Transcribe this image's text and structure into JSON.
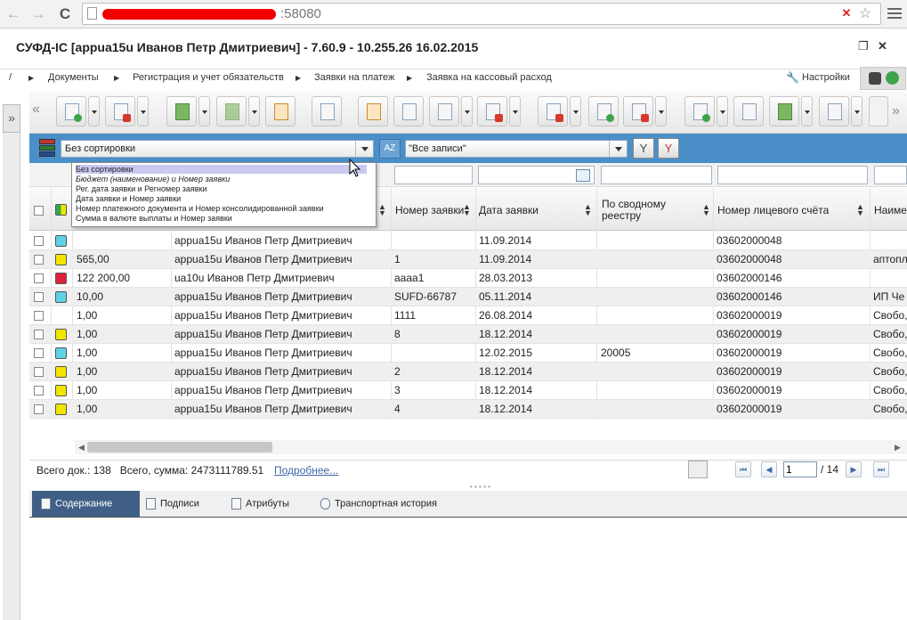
{
  "browser": {
    "back": "←",
    "forward": "→",
    "reload": "C",
    "url_tail": ":58080"
  },
  "app": {
    "title": "СУФД-IC [appua15u Иванов Петр Дмитриевич] - 7.60.9 - 10.255.26 16.02.2015",
    "restore_glyph": "❐",
    "close_glyph": "✕"
  },
  "breadcrumb": {
    "root": "/",
    "items": [
      "Документы",
      "Регистрация и учет обязательств",
      "Заявки на платеж",
      "Заявка на кассовый расход"
    ],
    "settings": "Настройки"
  },
  "left_rail": {
    "expand_glyph": "»"
  },
  "toolbar": {
    "collapse_glyph": "«"
  },
  "filter_bar": {
    "sort_value": "Без сортировки",
    "az_label": "AZ",
    "records_value": "\"Все записи\"",
    "filter_glyph": "Y",
    "clear_filter_glyph": "Y"
  },
  "sort_dropdown": {
    "options": [
      "Без сортировки",
      "Бюджет (наименование) и Номер заявки",
      "Рег. дата заявки и Регномер заявки",
      "Дата заявки и Номер заявки",
      "Номер платежного документа и Номер консолидированной заявки",
      "Сумма в валюте выплаты и Номер заявки"
    ]
  },
  "grid": {
    "headers": {
      "request_no": "Номер заявки",
      "request_date": "Дата заявки",
      "summary_registry_1": "По сводному",
      "summary_registry_2": "реестру",
      "account_no": "Номер лицевого счёта",
      "name": "Наиме"
    },
    "sort_glyph": "⬍",
    "rows": [
      {
        "status_color": "#5fd3e6",
        "amount": "",
        "author": "appua15u Иванов Петр Дмитриевич",
        "number": "",
        "date": "11.09.2014",
        "registry": "",
        "account": "03602000048",
        "name": ""
      },
      {
        "status_color": "#f2e600",
        "amount": "565,00",
        "author": "appua15u Иванов Петр Дмитриевич",
        "number": "1",
        "date": "11.09.2014",
        "registry": "",
        "account": "03602000048",
        "name": "аптопл"
      },
      {
        "status_color": "#e0213b",
        "amount": "122 200,00",
        "author": "ua10u Иванов Петр Дмитриевич",
        "number": "аааа1",
        "date": "28.03.2013",
        "registry": "",
        "account": "03602000146",
        "name": ""
      },
      {
        "status_color": "#5fd3e6",
        "amount": "10,00",
        "author": "appua15u Иванов Петр Дмитриевич",
        "number": "SUFD-66787",
        "date": "05.11.2014",
        "registry": "",
        "account": "03602000146",
        "name": "ИП Че"
      },
      {
        "status_color": "",
        "amount": "1,00",
        "author": "appua15u Иванов Петр Дмитриевич",
        "number": "1111",
        "date": "26.08.2014",
        "registry": "",
        "account": "03602000019",
        "name": "Свобо,"
      },
      {
        "status_color": "#f2e600",
        "amount": "1,00",
        "author": "appua15u Иванов Петр Дмитриевич",
        "number": "8",
        "date": "18.12.2014",
        "registry": "",
        "account": "03602000019",
        "name": "Свобо,"
      },
      {
        "status_color": "#5fd3e6",
        "amount": "1,00",
        "author": "appua15u Иванов Петр Дмитриевич",
        "number": "",
        "date": "12.02.2015",
        "registry": "20005",
        "account": "03602000019",
        "name": "Свобо,"
      },
      {
        "status_color": "#f2e600",
        "amount": "1,00",
        "author": "appua15u Иванов Петр Дмитриевич",
        "number": "2",
        "date": "18.12.2014",
        "registry": "",
        "account": "03602000019",
        "name": "Свобо,"
      },
      {
        "status_color": "#f2e600",
        "amount": "1,00",
        "author": "appua15u Иванов Петр Дмитриевич",
        "number": "3",
        "date": "18.12.2014",
        "registry": "",
        "account": "03602000019",
        "name": "Свобо,"
      },
      {
        "status_color": "#f2e600",
        "amount": "1,00",
        "author": "appua15u Иванов Петр Дмитриевич",
        "number": "4",
        "date": "18.12.2014",
        "registry": "",
        "account": "03602000019",
        "name": "Свобо,"
      }
    ]
  },
  "footer": {
    "summary": "Всего док.: 138   Всего, сумма: 2473111789.51",
    "more_link": "Подробнее...",
    "page_value": "1",
    "page_total": "/ 14",
    "first_glyph": "⏮",
    "prev_glyph": "◀",
    "next_glyph": "▶",
    "last_glyph": "⏭"
  },
  "tabs": [
    "Содержание",
    "Подписи",
    "Атрибуты",
    "Транспортная история"
  ]
}
